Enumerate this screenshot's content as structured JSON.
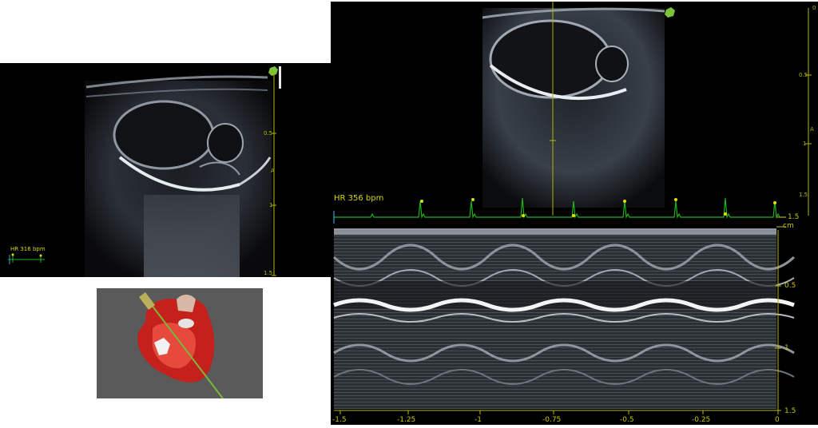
{
  "left_view": {
    "hr_label": "HR 316 bpm",
    "depth_ticks": [
      "0.5",
      "1",
      "1.5"
    ],
    "axis_marker": "A"
  },
  "right_view": {
    "bmode_depth_ticks": [
      "0",
      "0.5",
      "1",
      "1.5"
    ],
    "axis_marker": "A",
    "hr_label": "HR 356 bpm",
    "mmode_unit": "cm",
    "mmode_depth_ticks": [
      "1.5",
      "0.5",
      "1",
      "1.5"
    ],
    "time_ticks": [
      "-1.5",
      "-1.25",
      "-1",
      "-0.75",
      "-0.5",
      "-0.25",
      "0"
    ]
  },
  "colors": {
    "ecg": "#22b022",
    "scale": "#c8c800",
    "cursor": "#b4b400",
    "heart": "#c4201c",
    "needle": "#7ab83a"
  },
  "icons": [
    "probe-orientation-icon",
    "probe-orientation-icon",
    "heart-3d-model"
  ]
}
